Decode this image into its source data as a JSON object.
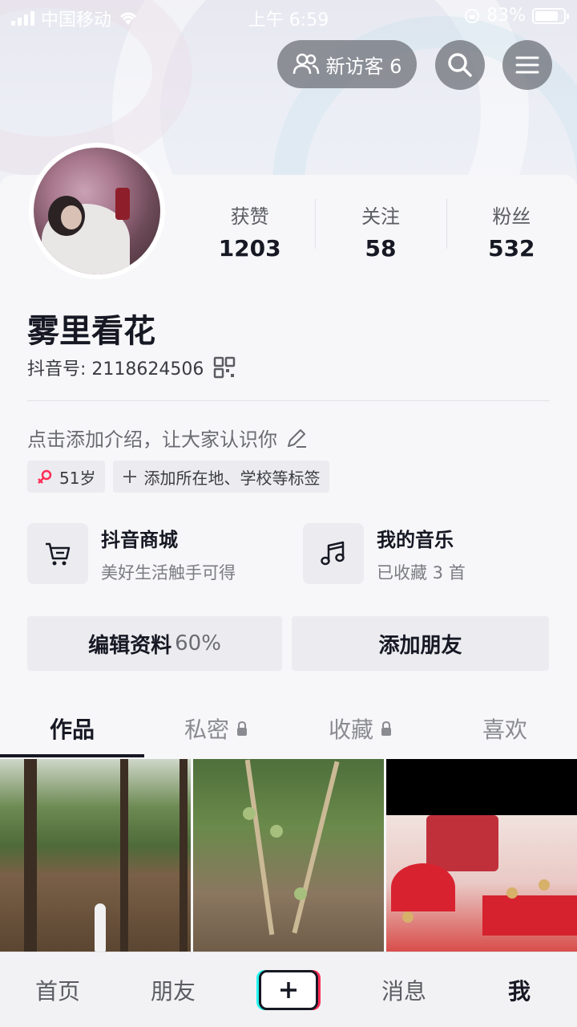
{
  "status_bar": {
    "carrier": "中国移动",
    "time": "上午 6:59",
    "battery": "83%",
    "battery_level": 0.83
  },
  "header": {
    "visitor_label": "新访客 6",
    "icons": [
      "visitors-icon",
      "search-icon",
      "menu-icon"
    ]
  },
  "profile": {
    "nickname": "雾里看花",
    "douyin_id": "抖音号: 2118624506",
    "bio_placeholder": "点击添加介绍，让大家认识你",
    "stats": [
      {
        "label": "获赞",
        "value": "1203"
      },
      {
        "label": "关注",
        "value": "58"
      },
      {
        "label": "粉丝",
        "value": "532"
      }
    ],
    "tags": {
      "age": "51岁",
      "add_tag": "添加所在地、学校等标签"
    }
  },
  "services": [
    {
      "title": "抖音商城",
      "subtitle": "美好生活触手可得",
      "icon": "cart-icon"
    },
    {
      "title": "我的音乐",
      "subtitle": "已收藏 3 首",
      "icon": "music-note-icon"
    }
  ],
  "actions": {
    "edit_profile": "编辑资料",
    "edit_progress": "60%",
    "add_friends": "添加朋友"
  },
  "tabs": [
    {
      "label": "作品",
      "active": true,
      "locked": false
    },
    {
      "label": "私密",
      "active": false,
      "locked": true
    },
    {
      "label": "收藏",
      "active": false,
      "locked": true
    },
    {
      "label": "喜欢",
      "active": false,
      "locked": false
    }
  ],
  "bottom_nav": {
    "home": "首页",
    "friends": "朋友",
    "messages": "消息",
    "me": "我"
  },
  "colors": {
    "text_primary": "#161823",
    "accent_cyan": "#25f4ee",
    "accent_red": "#fe2c55"
  }
}
